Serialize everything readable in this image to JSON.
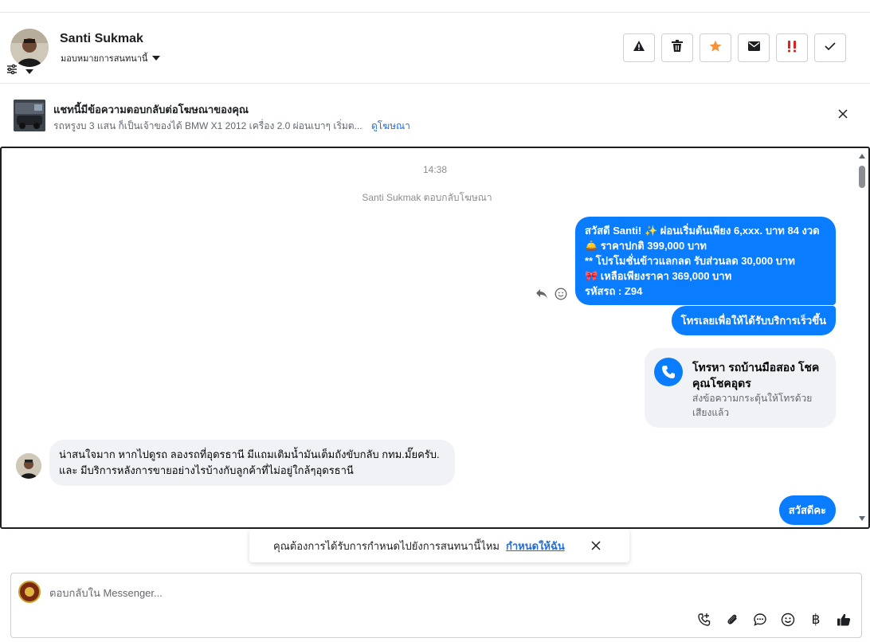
{
  "contact": {
    "name": "Santi Sukmak",
    "assign_label": "มอบหมายการสนทนานี้"
  },
  "actions": [
    {
      "name": "report-button",
      "icon": "warning-icon"
    },
    {
      "name": "delete-button",
      "icon": "trash-icon"
    },
    {
      "name": "star-button",
      "icon": "star-icon",
      "color": "#f7923b"
    },
    {
      "name": "mark-unread-button",
      "icon": "envelope-icon"
    },
    {
      "name": "follow-up-button",
      "icon": "exclamation-icon",
      "color": "#e02020"
    },
    {
      "name": "done-button",
      "icon": "check-icon"
    }
  ],
  "ad_bar": {
    "title": "แชทนี้มีข้อความตอบกลับต่อโฆษณาของคุณ",
    "description": "รถหรูงบ 3 แสน ก็เป็นเจ้าของได้ BMW X1 2012 เครื่อง 2.0 ผ่อนเบาๆ เริ่มต...",
    "link": "ดูโฆษณา"
  },
  "chat": {
    "time": "14:38",
    "system_note": "Santi Sukmak ตอบกลับโฆษณา",
    "outgoing_1": {
      "lines": [
        "สวัสดี Santi! ✨  ผ่อนเริ่มต้นเพียง 6,xxx. บาท 84 งวด",
        "🛎️ ราคาปกติ 399,000 บาท",
        "** โปรโมชั่นข้าวแลกลด รับส่วนลด 30,000 บาท",
        "🎀  เหลือเพียงราคา 369,000 บาท",
        " รหัสรถ : Z94"
      ]
    },
    "outgoing_2": "โทรเลยเพื่อให้ได้รับบริการเร็วขึ้น",
    "call_card": {
      "title": "โทรหา รถบ้านมือสอง โชคคุณโชคอุดร",
      "subtitle": "ส่งข้อความกระตุ้นให้โทรด้วยเสียงแล้ว"
    },
    "incoming": {
      "lines": [
        "น่าสนใจมาก หากไปดูรถ ลองรถที่อุดรธานี มีแถมเติมน้ำมันเต็มถังขับกลับ กทม.มั๊ยครับ.",
        "และ มีบริการหลังการขายอย่างไรบ้างกับลูกค้าที่ไม่อยู่ใกล้ๆอุดรธานี"
      ]
    },
    "outgoing_3": "สวัสดีคะ"
  },
  "toast": {
    "text": "คุณต้องการได้รับการกำหนดไปยังการสนทนานี้ไหม",
    "link": "กำหนดให้ฉัน"
  },
  "composer": {
    "placeholder": "ตอบกลับใน Messenger..."
  },
  "composer_icons": [
    "phone-plus-icon",
    "paperclip-icon",
    "chat-bubble-icon",
    "emoji-icon",
    "baht-icon",
    "thumbs-up-icon"
  ],
  "colors": {
    "accent": "#0a7cff",
    "link": "#216fdb",
    "incoming_bg": "#f0f2f5"
  }
}
